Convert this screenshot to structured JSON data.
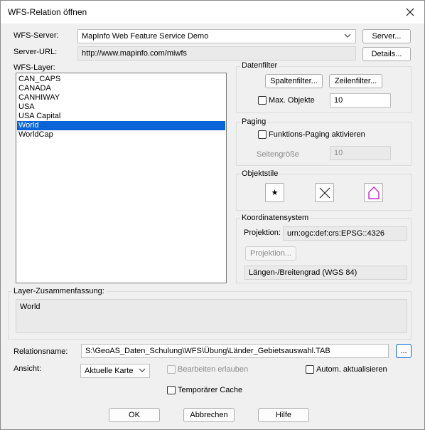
{
  "window": {
    "title": "WFS-Relation öffnen"
  },
  "server": {
    "label": "WFS-Server:",
    "value": "MapInfo Web Feature Service Demo",
    "button": "Server..."
  },
  "url": {
    "label": "Server-URL:",
    "value": "http://www.mapinfo.com/miwfs",
    "button": "Details..."
  },
  "layers": {
    "label": "WFS-Layer:",
    "items": [
      "CAN_CAPS",
      "CANADA",
      "CANHIWAY",
      "USA",
      "USA Capital",
      "World",
      "WorldCap"
    ],
    "selected": "World"
  },
  "datenfilter": {
    "title": "Datenfilter",
    "column_button": "Spaltenfilter...",
    "row_button": "Zeilenfilter...",
    "max_label": "Max. Objekte",
    "max_value": "10"
  },
  "paging": {
    "title": "Paging",
    "enable_label": "Funktions-Paging aktivieren",
    "size_label": "Seitengröße",
    "size_value": "10"
  },
  "objektstile": {
    "title": "Objektstile",
    "symbol_glyph": "★",
    "line_glyph": "✕"
  },
  "coord": {
    "title": "Koordinatensystem",
    "proj_label": "Projektion:",
    "proj_value": "urn:ogc:def:crs:EPSG::4326",
    "proj_button": "Projektion...",
    "name_value": "Längen-/Breitengrad (WGS 84)"
  },
  "summary": {
    "label": "Layer-Zusammenfassung:",
    "value": "World"
  },
  "relation": {
    "label": "Relationsname:",
    "value": "S:\\GeoAS_Daten_Schulung\\WFS\\Übung\\Länder_Gebietsauswahl.TAB",
    "browse": "..."
  },
  "view": {
    "label": "Ansicht:",
    "value": "Aktuelle Karte",
    "edit_label": "Bearbeiten erlauben",
    "auto_label": "Autom. aktualisieren"
  },
  "cache": {
    "label": "Temporärer Cache"
  },
  "buttons": {
    "ok": "OK",
    "cancel": "Abbrechen",
    "help": "Hilfe"
  }
}
